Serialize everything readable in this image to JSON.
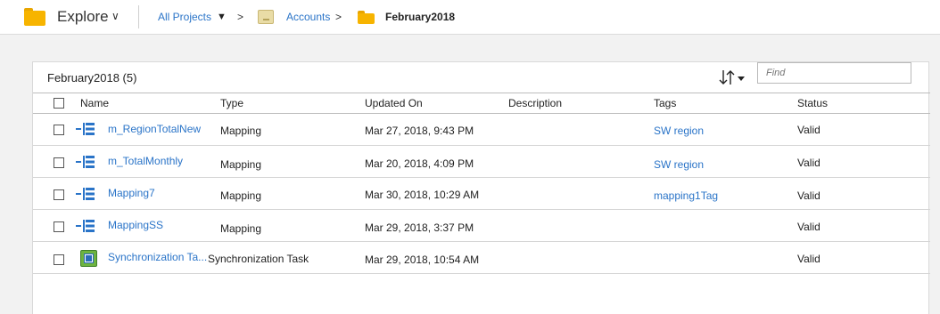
{
  "header": {
    "explore_label": "Explore",
    "explore_chevron": "∨",
    "breadcrumb": {
      "all_projects": "All Projects",
      "all_projects_caret": "▼",
      "sep1": ">",
      "accounts": "Accounts",
      "sep2": ">",
      "current": "February2018"
    }
  },
  "panel": {
    "title": "February2018 (5)",
    "find_placeholder": "Find",
    "columns": {
      "name": "Name",
      "type": "Type",
      "updated_on": "Updated On",
      "description": "Description",
      "tags": "Tags",
      "status": "Status"
    },
    "rows": [
      {
        "name": "m_RegionTotalNew",
        "icon": "mapping-icon",
        "type": "Mapping",
        "updated_on": "Mar 27, 2018, 9:43 PM",
        "description": "",
        "tags": "SW region",
        "status": "Valid"
      },
      {
        "name": "m_TotalMonthly",
        "icon": "mapping-icon",
        "type": "Mapping",
        "updated_on": "Mar 20, 2018, 4:09 PM",
        "description": "",
        "tags": "SW region",
        "status": "Valid"
      },
      {
        "name": "Mapping7",
        "icon": "mapping-icon",
        "type": "Mapping",
        "updated_on": "Mar 30, 2018, 10:29 AM",
        "description": "",
        "tags": "mapping1Tag",
        "status": "Valid"
      },
      {
        "name": "MappingSS",
        "icon": "mapping-icon",
        "type": "Mapping",
        "updated_on": "Mar 29, 2018, 3:37 PM",
        "description": "",
        "tags": "",
        "status": "Valid"
      },
      {
        "name": "Synchronization Ta...",
        "icon": "synchronization-task-icon",
        "type": "Synchronization Task",
        "updated_on": "Mar 29, 2018, 10:54 AM",
        "description": "",
        "tags": "",
        "status": "Valid"
      }
    ]
  },
  "colors": {
    "link": "#2a74c8",
    "folder": "#f7b400",
    "mapping_icon": "#2a74c8",
    "sync_icon": "#6db33f"
  }
}
